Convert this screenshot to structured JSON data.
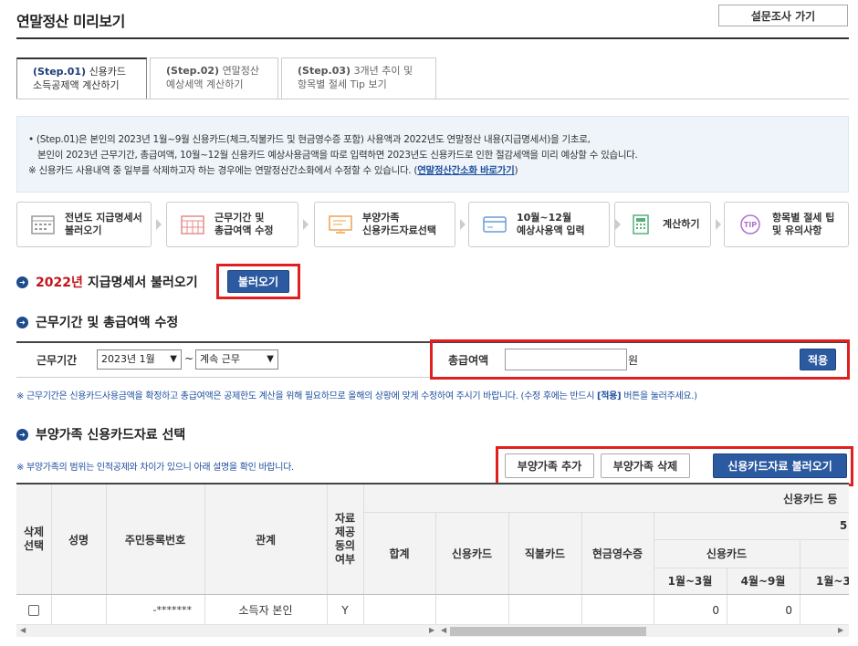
{
  "page": {
    "title": "연말정산 미리보기",
    "survey_button": "설문조사 가기"
  },
  "tabs": [
    {
      "step": "(Step.01)",
      "line1": "신용카드",
      "line2": "소득공제액 계산하기",
      "active": true
    },
    {
      "step": "(Step.02)",
      "line1": "연말정산",
      "line2": "예상세액 계산하기",
      "active": false
    },
    {
      "step": "(Step.03)",
      "line1": "3개년 추이 및",
      "line2": "항목별 절세 Tip 보기",
      "active": false
    }
  ],
  "info": {
    "line1": "• (Step.01)은 본인의 2023년 1월~9월 신용카드(체크,직불카드 및 현금영수증 포함) 사용액과 2022년도 연말정산 내용(지급명세서)을 기초로,",
    "line2": "본인이 2023년 근무기간, 총급여액, 10월~12월 신용카드 예상사용금액을 따로 입력하면 2023년도 신용카드로 인한 절감세액을 미리 예상할 수 있습니다.",
    "line3_prefix": "※ 신용카드 사용내역 중 일부를 삭제하고자 하는 경우에는 연말정산간소화에서 수정할 수 있습니다. (",
    "line3_link": "연말정산간소화 바로가기",
    "line3_suffix": ")"
  },
  "steps": [
    {
      "line1": "전년도 지급명세서",
      "line2": "불러오기",
      "color": "#999999"
    },
    {
      "line1": "근무기간 및",
      "line2": "총급여액 수정",
      "color": "#e88a8a"
    },
    {
      "line1": "부양가족",
      "line2": "신용카드자료선택",
      "color": "#f0a050"
    },
    {
      "line1": "10월~12월",
      "line2": "예상사용액 입력",
      "color": "#6a9ad8"
    },
    {
      "line1": "계산하기",
      "line2": "",
      "color": "#55b07a"
    },
    {
      "line1": "항목별 절세 팁",
      "line2": "및 유의사항",
      "color": "#b070d0"
    }
  ],
  "section1": {
    "year": "2022년",
    "title": "지급명세서 불러오기",
    "button": "불러오기"
  },
  "section2": {
    "title": "근무기간 및 총급여액 수정",
    "period_label": "근무기간",
    "start_value": "2023년 1월",
    "tilde": "~",
    "end_value": "계속 근무",
    "salary_label": "총급여액",
    "unit": "원",
    "apply_button": "적용",
    "note_prefix": "※ 근무기간은 신용카드사용금액을 확정하고 총급여액은 공제한도 계산을 위해 필요하므로 올해의 상황에 맞게 수정하여 주시기 바랍니다. (수정 후에는 반드시 ",
    "note_bold": "[적용]",
    "note_suffix": " 버튼을 눌러주세요.)"
  },
  "section3": {
    "title": "부양가족 신용카드자료 선택",
    "note": "※ 부양가족의 범위는 인적공제와 차이가 있으니 아래 설명을 확인 바랍니다.",
    "add_button": "부양가족 추가",
    "delete_button": "부양가족 삭제",
    "load_button": "신용카드자료 불러오기"
  },
  "table": {
    "headers": {
      "select": [
        "삭제",
        "선택"
      ],
      "name": "성명",
      "rrn": "주민등록번호",
      "relation": "관계",
      "consent": [
        "자료",
        "제공",
        "동의",
        "여부"
      ],
      "total": "합계",
      "credit": "신용카드",
      "debit": "직불카드",
      "cash": "현금영수증",
      "group_top": "신용카드 등",
      "group_sub": "5",
      "credit_sub": "신용카드",
      "m1_3": "1월~3월",
      "m4_9": "4월~9월",
      "m1_3b": "1월~3"
    },
    "rows": [
      {
        "name": "",
        "rrn": "-*******",
        "relation": "소득자 본인",
        "consent": "Y",
        "v1": "0",
        "v2": "0"
      }
    ]
  }
}
